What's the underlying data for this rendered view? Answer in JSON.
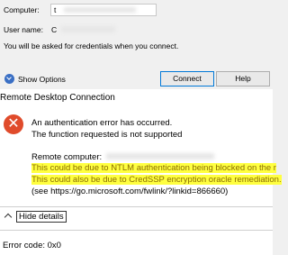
{
  "connect_dialog": {
    "computer_label": "Computer:",
    "computer_value": "t",
    "user_label": "User name:",
    "user_value": "C",
    "credentials_note": "You will be asked for credentials when you connect.",
    "show_options": "Show Options",
    "connect_button": "Connect",
    "help_button": "Help"
  },
  "error_dialog": {
    "title": "Remote Desktop Connection",
    "line1": "An authentication error has occurred.",
    "line2": "The function requested is not supported",
    "remote_label": "Remote computer:",
    "highlight1": "This could be due to NTLM authentication being blocked on the r",
    "highlight2": "This could also be due to CredSSP encryption oracle remediation.",
    "link_line": "(see https://go.microsoft.com/fwlink/?linkid=866660)",
    "hide_details": "Hide details",
    "error_code": "Error code: 0x0"
  }
}
